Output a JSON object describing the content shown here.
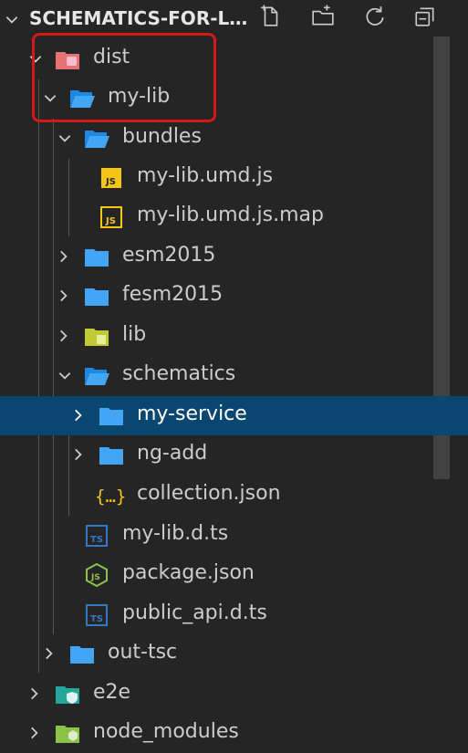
{
  "explorer": {
    "title": "SCHEMATICS-FOR-LI...",
    "actions": [
      "new-file",
      "new-folder",
      "refresh",
      "collapse-all"
    ]
  },
  "tree": [
    {
      "label": "dist",
      "icon": "dist-folder-icon",
      "expanded": true,
      "depth": 0
    },
    {
      "label": "my-lib",
      "icon": "folder-open-icon",
      "expanded": true,
      "depth": 1
    },
    {
      "label": "bundles",
      "icon": "folder-open-icon",
      "expanded": true,
      "depth": 2
    },
    {
      "label": "my-lib.umd.js",
      "icon": "js-file-icon",
      "depth": 3
    },
    {
      "label": "my-lib.umd.js.map",
      "icon": "js-map-file-icon",
      "depth": 3
    },
    {
      "label": "esm2015",
      "icon": "folder-icon",
      "expanded": false,
      "depth": 2
    },
    {
      "label": "fesm2015",
      "icon": "folder-icon",
      "expanded": false,
      "depth": 2
    },
    {
      "label": "lib",
      "icon": "lib-folder-icon",
      "expanded": false,
      "depth": 2
    },
    {
      "label": "schematics",
      "icon": "folder-open-icon",
      "expanded": true,
      "depth": 2
    },
    {
      "label": "my-service",
      "icon": "folder-icon",
      "expanded": false,
      "depth": 3,
      "selected": true
    },
    {
      "label": "ng-add",
      "icon": "folder-icon",
      "expanded": false,
      "depth": 3
    },
    {
      "label": "collection.json",
      "icon": "json-braces-icon",
      "depth": 3
    },
    {
      "label": "my-lib.d.ts",
      "icon": "ts-file-icon",
      "depth": 2
    },
    {
      "label": "package.json",
      "icon": "node-json-icon",
      "depth": 2
    },
    {
      "label": "public_api.d.ts",
      "icon": "ts-file-icon",
      "depth": 2
    },
    {
      "label": "out-tsc",
      "icon": "folder-icon",
      "expanded": false,
      "depth": 1
    },
    {
      "label": "e2e",
      "icon": "e2e-folder-icon",
      "expanded": false,
      "depth": 0
    },
    {
      "label": "node_modules",
      "icon": "node-folder-icon",
      "expanded": false,
      "depth": 0
    }
  ],
  "colors": {
    "background": "#252526",
    "selection": "#094771",
    "highlight_border": "#d11a1a",
    "folder_blue": "#42a5f5",
    "js_yellow": "#f5c518",
    "ts_blue": "#3178c6"
  }
}
